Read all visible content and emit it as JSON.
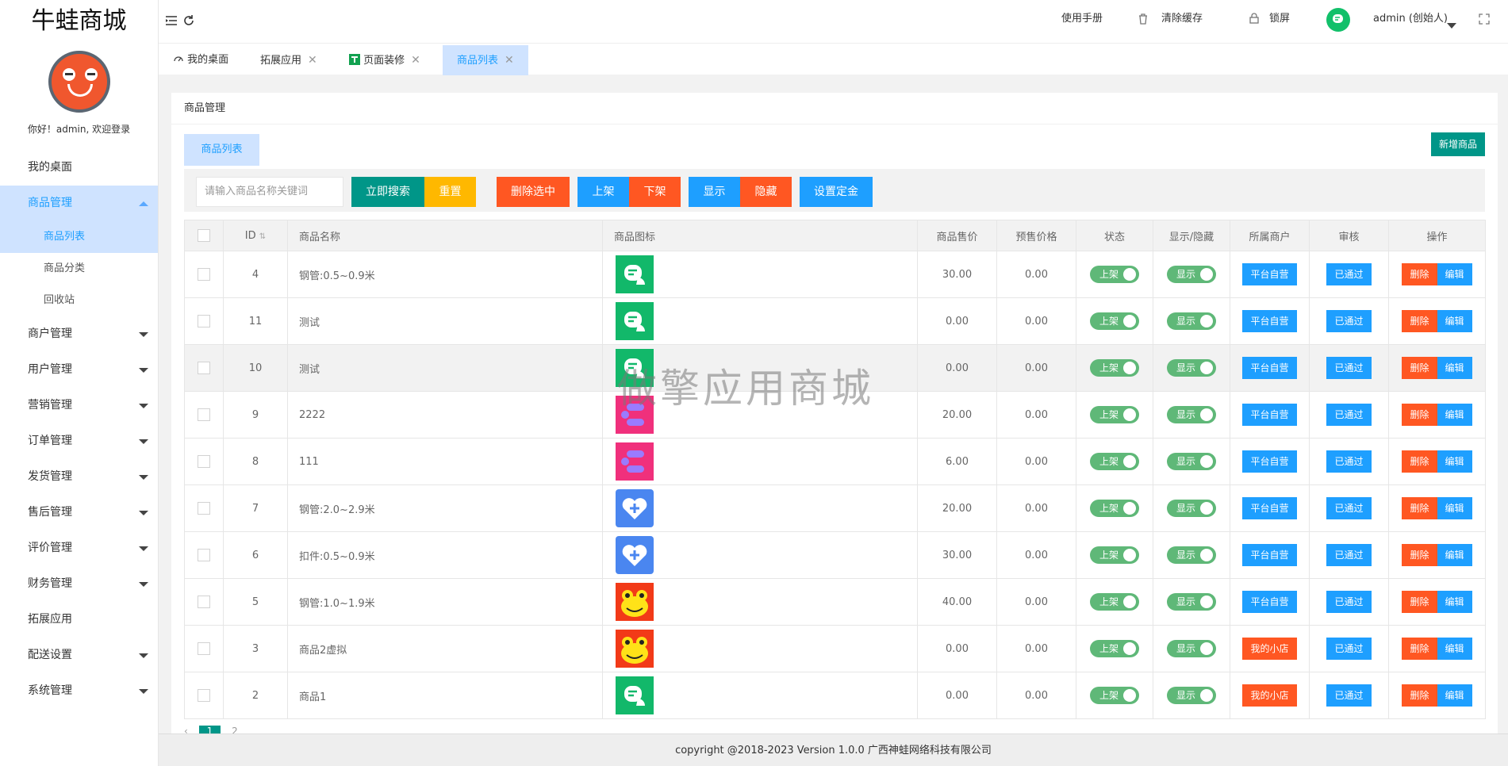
{
  "app": {
    "title": "牛蛙商城",
    "welcome": "你好！admin, 欢迎登录"
  },
  "sidebar": {
    "items": [
      {
        "label": "我的桌面"
      },
      {
        "label": "商品管理"
      },
      {
        "label": "商户管理"
      },
      {
        "label": "用户管理"
      },
      {
        "label": "营销管理"
      },
      {
        "label": "订单管理"
      },
      {
        "label": "发货管理"
      },
      {
        "label": "售后管理"
      },
      {
        "label": "评价管理"
      },
      {
        "label": "财务管理"
      },
      {
        "label": "拓展应用"
      },
      {
        "label": "配送设置"
      },
      {
        "label": "系统管理"
      }
    ],
    "sub": [
      {
        "label": "商品列表"
      },
      {
        "label": "商品分类"
      },
      {
        "label": "回收站"
      }
    ]
  },
  "header": {
    "manual": "使用手册",
    "clear_cache": "清除缓存",
    "lock": "锁屏",
    "user": "admin (创始人)"
  },
  "tabs": [
    {
      "label": "我的桌面"
    },
    {
      "label": "拓展应用"
    },
    {
      "label": "页面装修"
    },
    {
      "label": "商品列表"
    }
  ],
  "main": {
    "breadcrumb": "商品管理",
    "subtab": "商品列表",
    "new_button": "新增商品",
    "search_placeholder": "请输入商品名称关键词",
    "buttons": {
      "search": "立即搜索",
      "reset": "重置",
      "delete_selected": "删除选中",
      "on_shelf": "上架",
      "off_shelf": "下架",
      "show": "显示",
      "hide": "隐藏",
      "deposit": "设置定金"
    },
    "columns": [
      "ID",
      "商品名称",
      "商品图标",
      "商品售价",
      "预售价格",
      "状态",
      "显示/隐藏",
      "所属商户",
      "审核",
      "操作"
    ],
    "rows": [
      {
        "id": "4",
        "name": "钢管:0.5~0.9米",
        "icon": "chat",
        "price": "30.00",
        "presale": "0.00",
        "status": "上架",
        "display": "显示",
        "merchant": "平台自营",
        "audit": "已通过"
      },
      {
        "id": "11",
        "name": "测试",
        "icon": "chat",
        "price": "0.00",
        "presale": "0.00",
        "status": "上架",
        "display": "显示",
        "merchant": "平台自营",
        "audit": "已通过"
      },
      {
        "id": "10",
        "name": "测试",
        "icon": "chat",
        "price": "0.00",
        "presale": "0.00",
        "status": "上架",
        "display": "显示",
        "merchant": "平台自营",
        "audit": "已通过"
      },
      {
        "id": "9",
        "name": "2222",
        "icon": "flow",
        "price": "20.00",
        "presale": "0.00",
        "status": "上架",
        "display": "显示",
        "merchant": "平台自营",
        "audit": "已通过"
      },
      {
        "id": "8",
        "name": "111",
        "icon": "flow",
        "price": "6.00",
        "presale": "0.00",
        "status": "上架",
        "display": "显示",
        "merchant": "平台自营",
        "audit": "已通过"
      },
      {
        "id": "7",
        "name": "钢管:2.0~2.9米",
        "icon": "heart",
        "price": "20.00",
        "presale": "0.00",
        "status": "上架",
        "display": "显示",
        "merchant": "平台自营",
        "audit": "已通过"
      },
      {
        "id": "6",
        "name": "扣件:0.5~0.9米",
        "icon": "heart",
        "price": "30.00",
        "presale": "0.00",
        "status": "上架",
        "display": "显示",
        "merchant": "平台自营",
        "audit": "已通过"
      },
      {
        "id": "5",
        "name": "钢管:1.0~1.9米",
        "icon": "frog",
        "price": "40.00",
        "presale": "0.00",
        "status": "上架",
        "display": "显示",
        "merchant": "平台自营",
        "audit": "已通过"
      },
      {
        "id": "3",
        "name": "商品2虚拟",
        "icon": "frog",
        "price": "0.00",
        "presale": "0.00",
        "status": "上架",
        "display": "显示",
        "merchant": "我的小店",
        "audit": "已通过"
      },
      {
        "id": "2",
        "name": "商品1",
        "icon": "chat",
        "price": "0.00",
        "presale": "0.00",
        "status": "上架",
        "display": "显示",
        "merchant": "我的小店",
        "audit": "已通过"
      }
    ],
    "row_actions": {
      "delete": "删除",
      "edit": "编辑"
    },
    "pager": {
      "current": "1",
      "next": "2"
    }
  },
  "watermark": "做擎应用商城",
  "footer": "copyright @2018-2023 Version 1.0.0 广西神蛙网络科技有限公司",
  "colors": {
    "primary": "#1e9fff",
    "teal": "#009688",
    "orange": "#ffb800",
    "red": "#ff5722",
    "green": "#5fb878"
  }
}
